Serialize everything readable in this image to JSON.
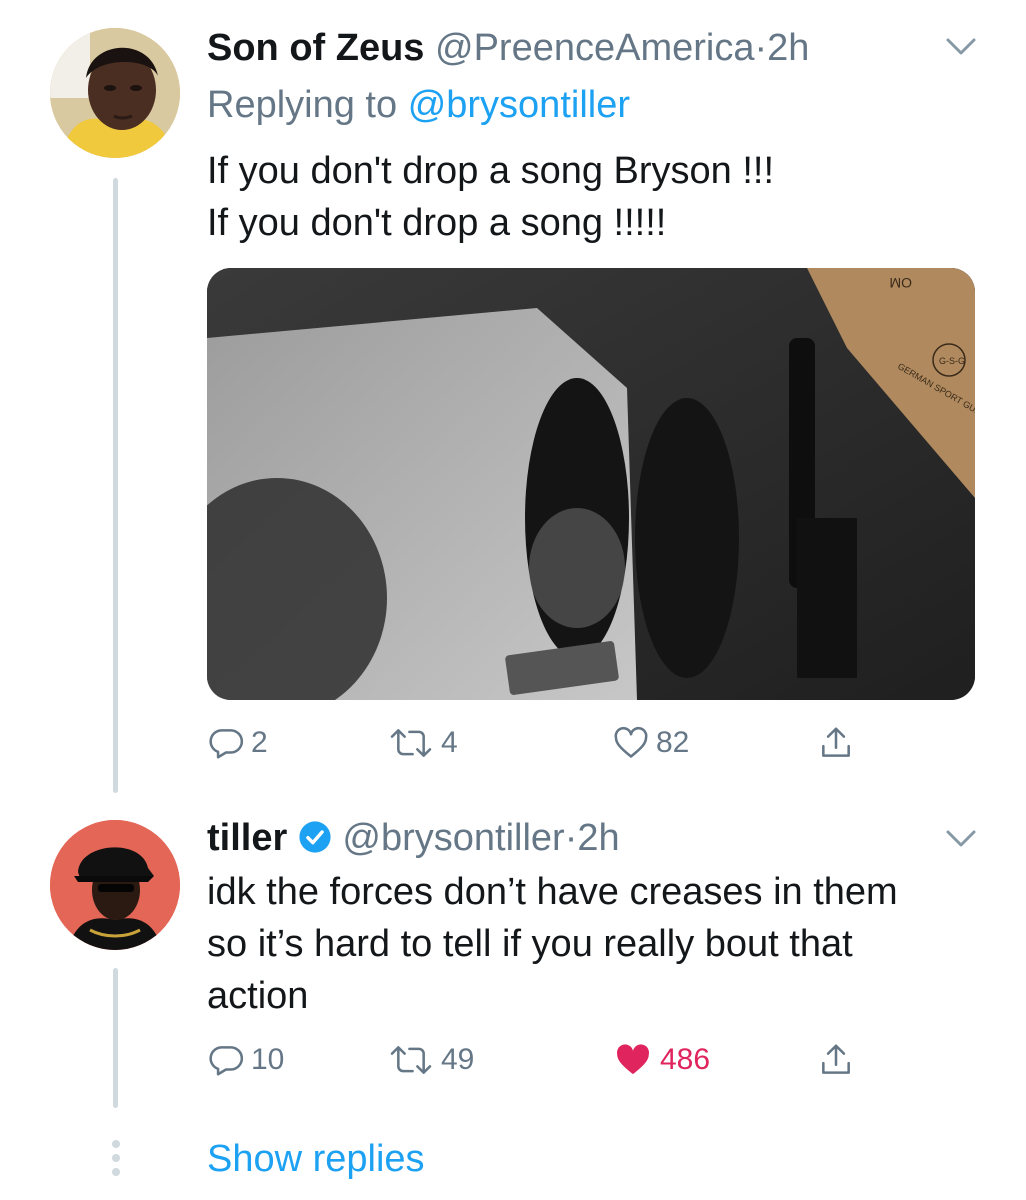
{
  "tweet1": {
    "name": "Son of Zeus",
    "handle": "@PreenceAmerica",
    "separator": "·",
    "time": "2h",
    "replying_prefix": "Replying to",
    "replying_to": "@brysontiller",
    "text": "If you don't drop a song Bryson !!!\nIf you don't drop a song !!!!!",
    "photo": {
      "box_brand": "GERMAN SPORT GUN",
      "box_logo": "G-S-G",
      "box_corner_text": "OM"
    },
    "replies": "2",
    "retweets": "4",
    "likes": "82",
    "icons": [
      "avatar",
      "chevron-down-icon",
      "reply-icon",
      "retweet-icon",
      "like-icon",
      "share-icon"
    ]
  },
  "tweet2": {
    "name": "tiller",
    "verified": true,
    "handle": "@brysontiller",
    "separator": "·",
    "time": "2h",
    "text": "idk the forces don’t have creases in them\nso it’s hard to tell if you really bout that\naction",
    "replies": "10",
    "retweets": "49",
    "likes": "486",
    "liked": true,
    "icons": [
      "avatar",
      "verified-badge-icon",
      "chevron-down-icon",
      "reply-icon",
      "retweet-icon",
      "like-icon-filled",
      "share-icon"
    ]
  },
  "footer": {
    "show_replies": "Show replies"
  },
  "colors": {
    "link": "#1da1f2",
    "muted": "#657786",
    "like": "#e0245e",
    "thread": "#cfd9de"
  }
}
